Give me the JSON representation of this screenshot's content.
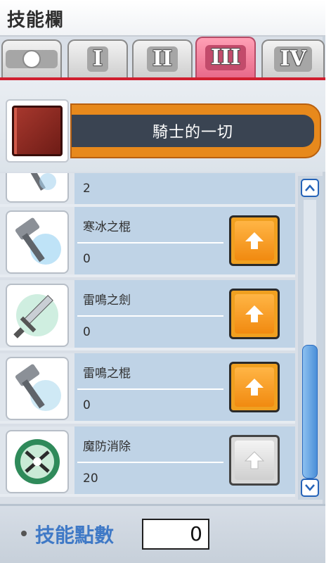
{
  "window": {
    "title": "技能欄"
  },
  "tabs": [
    {
      "label": "",
      "active": false,
      "icon": "circle-icon"
    },
    {
      "label": "I",
      "active": false
    },
    {
      "label": "II",
      "active": false
    },
    {
      "label": "III",
      "active": true
    },
    {
      "label": "IV",
      "active": false
    }
  ],
  "job": {
    "name": "騎士的一切",
    "icon": "book-icon"
  },
  "skills": [
    {
      "name": "",
      "level": "2",
      "icon": "hammer-icon",
      "button": "up-arrow-icon",
      "enabled": true
    },
    {
      "name": "寒冰之棍",
      "level": "0",
      "icon": "ice-hammer-icon",
      "button": "up-arrow-icon",
      "enabled": true
    },
    {
      "name": "雷鳴之劍",
      "level": "0",
      "icon": "lightning-sword-icon",
      "button": "up-arrow-icon",
      "enabled": true
    },
    {
      "name": "雷鳴之棍",
      "level": "0",
      "icon": "lightning-hammer-icon",
      "button": "up-arrow-icon",
      "enabled": true
    },
    {
      "name": "魔防消除",
      "level": "20",
      "icon": "magic-crash-icon",
      "button": "up-arrow-icon",
      "enabled": false
    }
  ],
  "footer": {
    "label": "技能點數",
    "points": "0"
  },
  "colors": {
    "active_tab": "#e86a8a",
    "accent_red": "#d01f2f",
    "button_orange": "#f0a020",
    "scroll_blue": "#4b8fd8"
  }
}
